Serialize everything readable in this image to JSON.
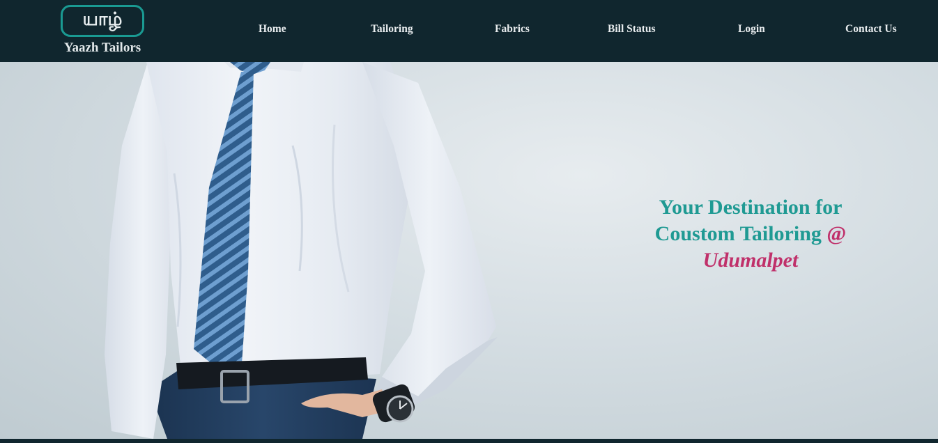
{
  "brand": {
    "logo_text": "யாழ்",
    "name": "Yaazh Tailors"
  },
  "nav": {
    "items": [
      {
        "label": "Home"
      },
      {
        "label": "Tailoring"
      },
      {
        "label": "Fabrics"
      },
      {
        "label": "Bill Status"
      },
      {
        "label": "Login"
      },
      {
        "label": "Contact Us"
      }
    ]
  },
  "hero": {
    "image_icon": "man-in-shirt-and-tie-photo",
    "tagline": {
      "line1": "Your Destination for",
      "line2": "Coustom Tailoring",
      "at_symbol": "@",
      "line3": "Udumalpet"
    }
  },
  "colors": {
    "navbar_bg": "#10262e",
    "accent_teal": "#1f9a93",
    "accent_pink": "#c0306a",
    "nav_text": "#e8ecee"
  }
}
